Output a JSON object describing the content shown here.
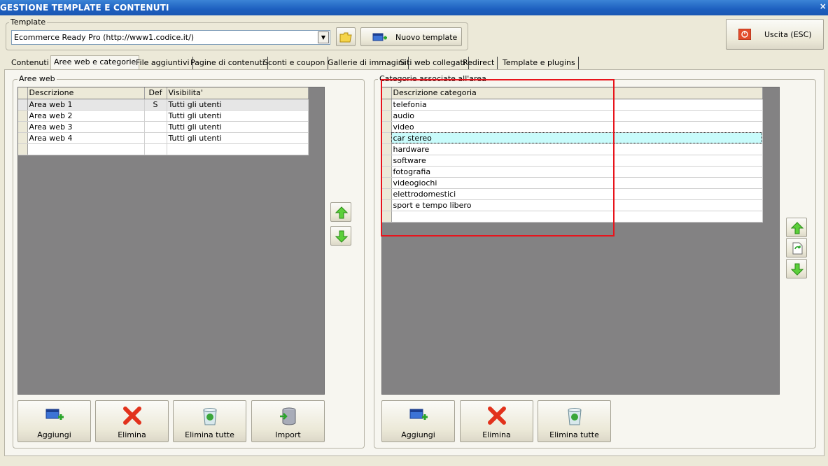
{
  "window": {
    "title": "GESTIONE TEMPLATE E CONTENUTI",
    "close_glyph": "×"
  },
  "template": {
    "legend": "Template",
    "selected": "Ecommerce Ready Pro (http://www1.codice.it/)",
    "new_button_label": "Nuovo template"
  },
  "exit_button_label": "Uscita (ESC)",
  "tabs": [
    {
      "label": "Contenuti"
    },
    {
      "label": "Aree web e categorie",
      "active": true
    },
    {
      "label": "File aggiuntivi"
    },
    {
      "label": "Pagine di contenuti"
    },
    {
      "label": "Sconti e coupon"
    },
    {
      "label": "Gallerie di immagini"
    },
    {
      "label": "Siti web collegati"
    },
    {
      "label": "Redirect"
    },
    {
      "label": "Template e plugins"
    }
  ],
  "aree_web": {
    "legend": "Aree web",
    "columns": [
      "Descrizione",
      "Def",
      "Visibilita'"
    ],
    "rows": [
      [
        "Area web 1",
        "S",
        "Tutti gli utenti"
      ],
      [
        "Area web 2",
        "",
        "Tutti gli utenti"
      ],
      [
        "Area web 3",
        "",
        "Tutti gli utenti"
      ],
      [
        "Area web 4",
        "",
        "Tutti gli utenti"
      ]
    ],
    "actions": [
      "Aggiungi",
      "Elimina",
      "Elimina tutte",
      "Import"
    ]
  },
  "categorie": {
    "legend": "Categorie associate all'area",
    "column": "Descrizione categoria",
    "rows": [
      "telefonia",
      "audio",
      "video",
      "car stereo",
      "hardware",
      "software",
      "fotografia",
      "videogiochi",
      "elettrodomestici",
      "sport e tempo libero"
    ],
    "focused_index": 3,
    "actions": [
      "Aggiungi",
      "Elimina",
      "Elimina tutte"
    ]
  },
  "colors": {
    "highlight_box": "#e8141c",
    "focus_row": "#c8fbfb",
    "titlebar": "#1d5fbf"
  }
}
